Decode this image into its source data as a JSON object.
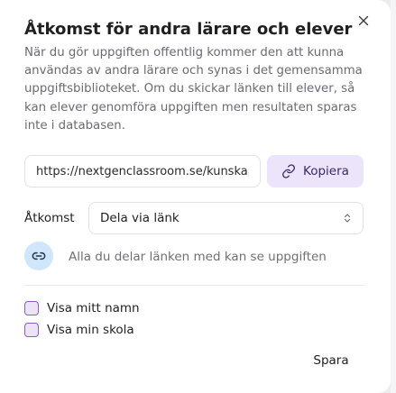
{
  "dialog": {
    "title": "Åtkomst för andra lärare och elever",
    "description": "När du gör uppgiften offentlig kommer den att kunna användas av andra lärare och synas i det gemensamma uppgiftsbiblioteket. Om du skickar länken till elever, så kan elever genomföra uppgiften men resultaten sparas inte i databasen.",
    "close_icon": "close-icon"
  },
  "share": {
    "link_value": "https://nextgenclassroom.se/kunskap",
    "copy_label": "Kopiera",
    "copy_icon": "link-icon"
  },
  "access": {
    "label": "Åtkomst",
    "selected": "Dela via länk",
    "select_icon": "chevron-updown-icon"
  },
  "info": {
    "icon": "link-icon",
    "text": "Alla du delar länken med kan se uppgiften"
  },
  "options": [
    {
      "label": "Visa mitt namn",
      "checked": false
    },
    {
      "label": "Visa min skola",
      "checked": false
    }
  ],
  "footer": {
    "save_label": "Spara"
  },
  "colors": {
    "accent_bg": "#ece4fb",
    "accent_text": "#3b2a63",
    "checkbox_border": "#8a5cc4",
    "info_bg": "#cfe6fb"
  }
}
